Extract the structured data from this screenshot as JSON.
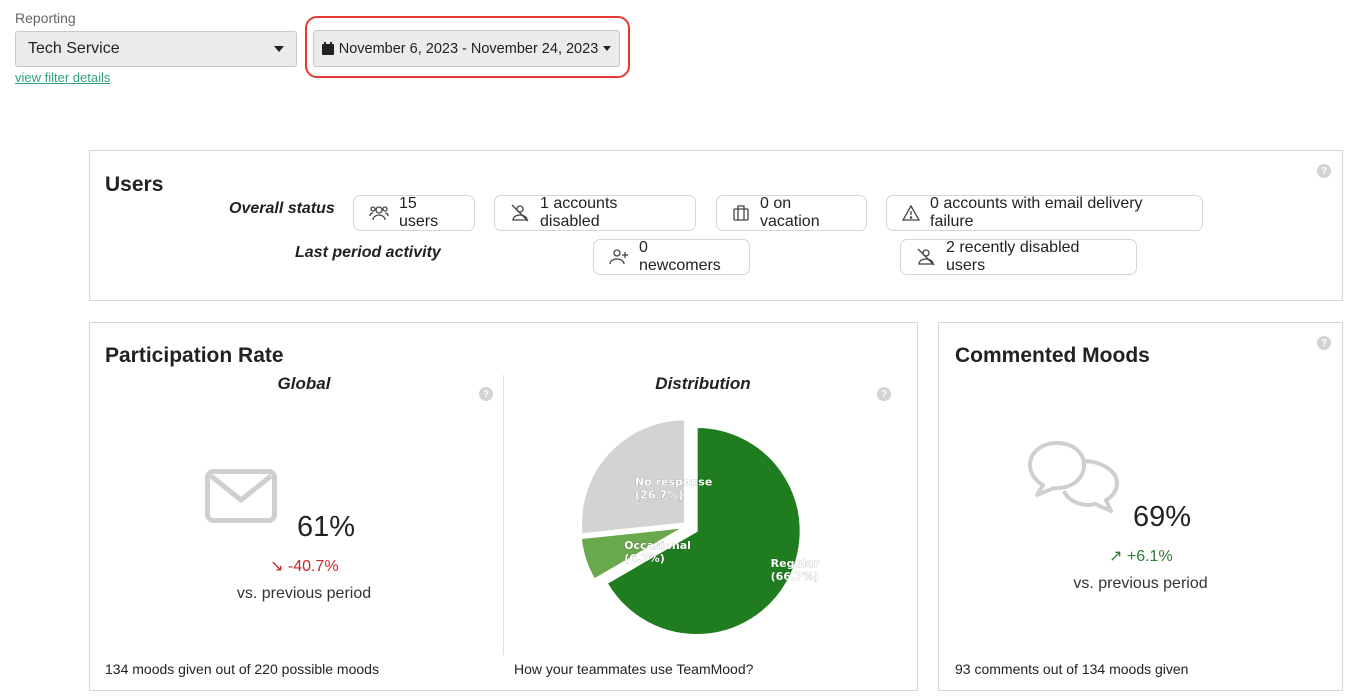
{
  "filter": {
    "reporting_label": "Reporting",
    "team_value": "Tech Service",
    "view_filter_link": "view filter details",
    "date_range": "November 6, 2023 - November 24, 2023"
  },
  "users": {
    "title": "Users",
    "overall_status_label": "Overall status",
    "last_period_label": "Last period activity",
    "users_count": "15 users",
    "accounts_disabled": "1 accounts disabled",
    "on_vacation": "0 on vacation",
    "email_failure": "0 accounts with email delivery failure",
    "newcomers": "0 newcomers",
    "recently_disabled": "2 recently disabled users",
    "help": "?"
  },
  "participation": {
    "title": "Participation Rate",
    "global_title": "Global",
    "distribution_title": "Distribution",
    "rate": "61%",
    "delta": "-40.7%",
    "delta_arrow": "↘",
    "delta_color": "#c62828",
    "vs_text": "vs. previous period",
    "footer_global": "134 moods given out of 220 possible moods",
    "footer_distribution": "How your teammates use TeamMood?",
    "help": "?"
  },
  "chart_data": {
    "type": "pie",
    "slices": [
      {
        "label": "Regular",
        "value": 66.7,
        "value_label": "(66.7%)",
        "color": "#1f7d1f"
      },
      {
        "label": "Occasional",
        "value": 6.7,
        "value_label": "(6.7%)",
        "color": "#6aa84f"
      },
      {
        "label": "No response",
        "value": 26.7,
        "value_label": "(26.7%)",
        "color": "#d3d3d3"
      }
    ]
  },
  "moods": {
    "title": "Commented Moods",
    "rate": "69%",
    "delta": "+6.1%",
    "delta_arrow": "↗",
    "delta_color": "#2e7d32",
    "vs_text": "vs. previous period",
    "footer": "93 comments out of 134 moods given",
    "help": "?"
  }
}
